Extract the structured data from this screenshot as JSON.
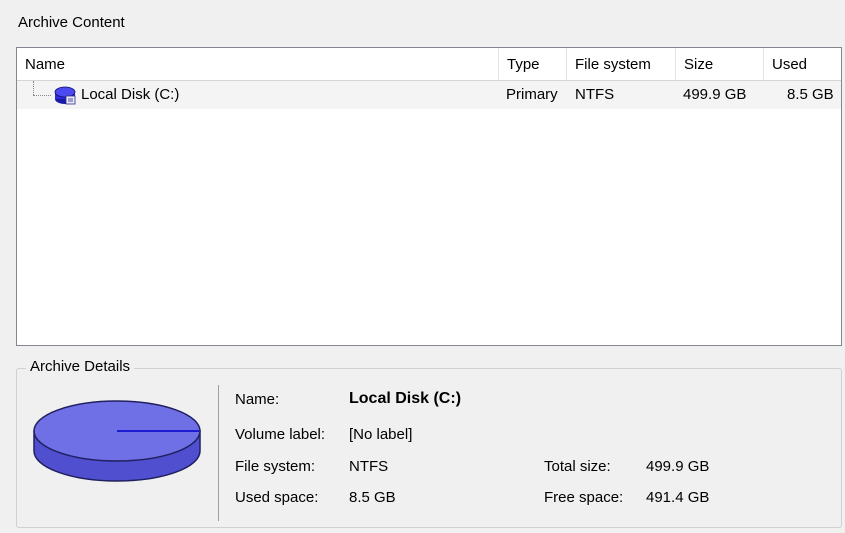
{
  "archive_content": {
    "title": "Archive Content",
    "columns": [
      "Name",
      "Type",
      "File system",
      "Size",
      "Used"
    ],
    "rows": [
      {
        "name": "Local Disk (C:)",
        "type": "Primary",
        "file_system": "NTFS",
        "size": "499.9 GB",
        "used": "8.5 GB"
      }
    ]
  },
  "archive_details": {
    "title": "Archive Details",
    "name_label": "Name:",
    "name_value": "Local Disk (C:)",
    "volume_label_label": "Volume label:",
    "volume_label_value": "[No label]",
    "file_system_label": "File system:",
    "file_system_value": "NTFS",
    "used_space_label": "Used space:",
    "used_space_value": "8.5 GB",
    "total_size_label": "Total size:",
    "total_size_value": "499.9 GB",
    "free_space_label": "Free space:",
    "free_space_value": "491.4 GB",
    "usage_fraction": 0.017
  },
  "colors": {
    "pie_fill": "#6f6fe6",
    "pie_side": "#4f4fd0",
    "used_marker": "#1c1cd4"
  }
}
